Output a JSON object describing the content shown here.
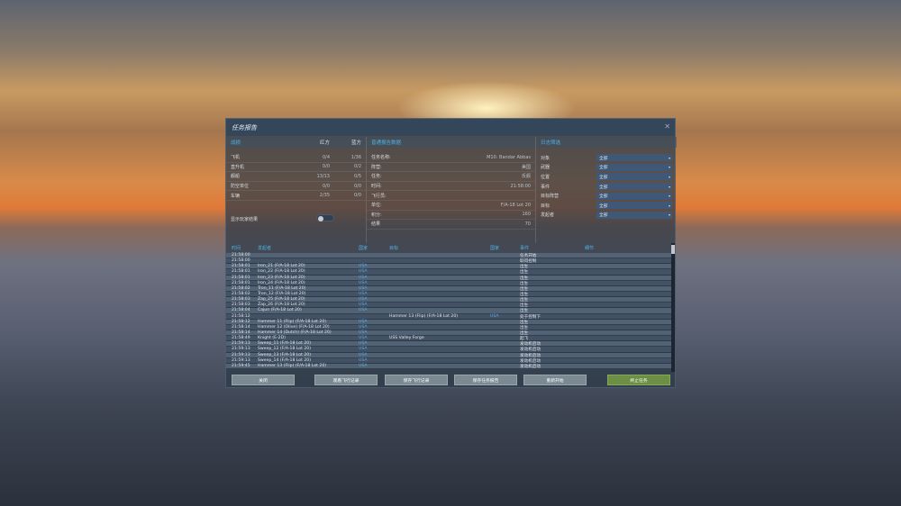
{
  "title": "任务报告",
  "stats": {
    "header": "战损",
    "red": "红方",
    "blue": "蓝方",
    "rows": [
      {
        "label": "飞机",
        "red": "0/4",
        "blue": "1/36"
      },
      {
        "label": "直升机",
        "red": "0/0",
        "blue": "0/2"
      },
      {
        "label": "舰船",
        "red": "13/13",
        "blue": "0/5"
      },
      {
        "label": "防空单位",
        "red": "0/0",
        "blue": "0/0"
      },
      {
        "label": "车辆",
        "red": "2/35",
        "blue": "0/0"
      }
    ],
    "toggle_label": "显示玩家结果",
    "toggle_on": false
  },
  "info": {
    "header": "普通报告数据",
    "rows": [
      {
        "label": "任务名称:",
        "value": "M10: Bandar Abbas"
      },
      {
        "label": "阵营:",
        "value": "美国"
      },
      {
        "label": "任务:",
        "value": "反舰"
      },
      {
        "label": "时间:",
        "value": "21:58:00"
      },
      {
        "label": "飞行员:",
        "value": ""
      },
      {
        "label": "单位:",
        "value": "F/A-18 Lot 20"
      },
      {
        "label": "积分:",
        "value": "160"
      },
      {
        "label": "结果",
        "value": "70"
      }
    ]
  },
  "filters": {
    "header": "日志筛选",
    "rows": [
      {
        "label": "对象",
        "value": "全部"
      },
      {
        "label": "武器",
        "value": "全部"
      },
      {
        "label": "位置",
        "value": "全部"
      },
      {
        "label": "事件",
        "value": "全部"
      },
      {
        "label": "目标阵营",
        "value": "全部"
      },
      {
        "label": "目标",
        "value": "全部"
      },
      {
        "label": "发起者",
        "value": "全部"
      }
    ]
  },
  "log": {
    "columns": [
      "时间",
      "发起者",
      "国家",
      "目标",
      "国家",
      "事件",
      "细节"
    ],
    "rows": [
      [
        "21:58:00",
        "",
        "",
        "",
        "",
        "任务开始",
        ""
      ],
      [
        "21:58:00",
        "",
        "",
        "",
        "",
        "取得控制",
        ""
      ],
      [
        "21:58:01",
        "Iron_21 (F/A-18 Lot 20)",
        "USA",
        "",
        "",
        "出生",
        ""
      ],
      [
        "21:58:01",
        "Iron_22 (F/A-18 Lot 20)",
        "USA",
        "",
        "",
        "出生",
        ""
      ],
      [
        "21:58:01",
        "Iron_23 (F/A-18 Lot 20)",
        "USA",
        "",
        "",
        "出生",
        ""
      ],
      [
        "21:58:01",
        "Iron_24 (F/A-18 Lot 20)",
        "USA",
        "",
        "",
        "出生",
        ""
      ],
      [
        "21:58:02",
        "Tron_11 (F/A-18 Lot 20)",
        "USA",
        "",
        "",
        "出生",
        ""
      ],
      [
        "21:58:02",
        "Tron_12 (F/A-18 Lot 20)",
        "USA",
        "",
        "",
        "出生",
        ""
      ],
      [
        "21:58:03",
        "Zap_25 (F/A-18 Lot 20)",
        "USA",
        "",
        "",
        "出生",
        ""
      ],
      [
        "21:58:03",
        "Zap_26 (F/A-18 Lot 20)",
        "USA",
        "",
        "",
        "出生",
        ""
      ],
      [
        "21:58:04",
        "Cajun (F/A-18 Lot 20)",
        "USA",
        "",
        "",
        "出生",
        ""
      ],
      [
        "21:58:12",
        "",
        "",
        "Hammer 13 (Flip) (F/A-18 Lot 20)",
        "USA",
        "处于控制下",
        ""
      ],
      [
        "21:58:12",
        "Hammer 11 (Flip) (F/A-18 Lot 20)",
        "USA",
        "",
        "",
        "出生",
        ""
      ],
      [
        "21:58:14",
        "Hammer 12 (Olive) (F/A-18 Lot 20)",
        "USA",
        "",
        "",
        "出生",
        ""
      ],
      [
        "21:58:14",
        "Hammer 14 (Dutch) (F/A-18 Lot 20)",
        "USA",
        "",
        "",
        "出生",
        ""
      ],
      [
        "21:58:49",
        "Knight (E-2D)",
        "USA",
        "USS Valley Forge",
        "",
        "起飞",
        ""
      ],
      [
        "21:59:13",
        "Sweep_11 (F/A-18 Lot 20)",
        "USA",
        "",
        "",
        "发动机启动",
        ""
      ],
      [
        "21:59:13",
        "Sweep_12 (F/A-18 Lot 20)",
        "USA",
        "",
        "",
        "发动机启动",
        ""
      ],
      [
        "21:59:13",
        "Sweep_13 (F/A-18 Lot 20)",
        "USA",
        "",
        "",
        "发动机启动",
        ""
      ],
      [
        "21:59:13",
        "Sweep_14 (F/A-18 Lot 20)",
        "USA",
        "",
        "",
        "发动机启动",
        ""
      ],
      [
        "21:59:45",
        "Hammer 13 (Flip) (F/A-18 Lot 20)",
        "USA",
        "",
        "",
        "发动机启动",
        ""
      ]
    ]
  },
  "buttons": [
    "关闭",
    "观看飞行记录",
    "保存飞行记录",
    "保存任务报告",
    "重新开始",
    "终止任务"
  ]
}
